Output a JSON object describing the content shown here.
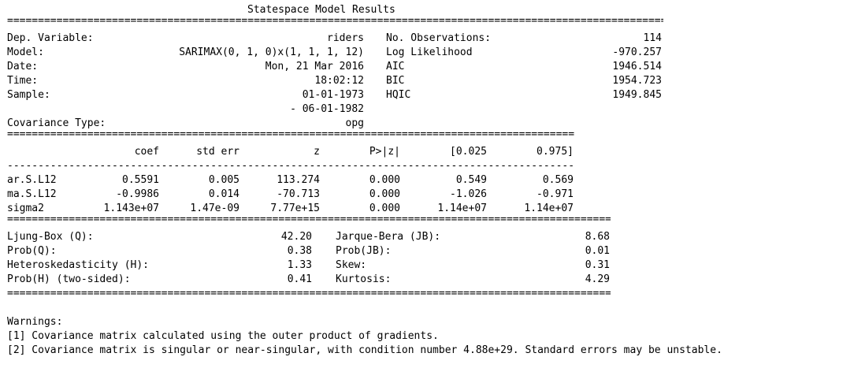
{
  "title": "Statespace Model Results",
  "header": {
    "dep_variable_label": "Dep. Variable:",
    "dep_variable_value": "riders",
    "model_label": "Model:",
    "model_value": "SARIMAX(0, 1, 0)x(1, 1, 1, 12)",
    "date_label": "Date:",
    "date_value": "Mon, 21 Mar 2016",
    "time_label": "Time:",
    "time_value": "18:02:12",
    "sample_label": "Sample:",
    "sample_value_1": "01-01-1973",
    "sample_value_2": "- 06-01-1982",
    "covtype_label": "Covariance Type:",
    "covtype_value": "opg",
    "nobs_label": "No. Observations:",
    "nobs_value": "114",
    "llf_label": "Log Likelihood",
    "llf_value": "-970.257",
    "aic_label": "AIC",
    "aic_value": "1946.514",
    "bic_label": "BIC",
    "bic_value": "1954.723",
    "hqic_label": "HQIC",
    "hqic_value": "1949.845"
  },
  "coef_table": {
    "columns": [
      "coef",
      "std err",
      "z",
      "P>|z|",
      "[0.025",
      "0.975]"
    ],
    "rows": [
      {
        "name": "ar.S.L12",
        "coef": "0.5591",
        "std_err": "0.005",
        "z": "113.274",
        "p": "0.000",
        "lo": "0.549",
        "hi": "0.569"
      },
      {
        "name": "ma.S.L12",
        "coef": "-0.9986",
        "std_err": "0.014",
        "z": "-70.713",
        "p": "0.000",
        "lo": "-1.026",
        "hi": "-0.971"
      },
      {
        "name": "sigma2",
        "coef": "1.143e+07",
        "std_err": "1.47e-09",
        "z": "7.77e+15",
        "p": "0.000",
        "lo": "1.14e+07",
        "hi": "1.14e+07"
      }
    ]
  },
  "diagnostics": {
    "left": [
      {
        "label": "Ljung-Box (Q):",
        "value": "42.20"
      },
      {
        "label": "Prob(Q):",
        "value": "0.38"
      },
      {
        "label": "Heteroskedasticity (H):",
        "value": "1.33"
      },
      {
        "label": "Prob(H) (two-sided):",
        "value": "0.41"
      }
    ],
    "right": [
      {
        "label": "Jarque-Bera (JB):",
        "value": "8.68"
      },
      {
        "label": "Prob(JB):",
        "value": "0.01"
      },
      {
        "label": "Skew:",
        "value": "0.31"
      },
      {
        "label": "Kurtosis:",
        "value": "4.29"
      }
    ]
  },
  "warnings": {
    "heading": "Warnings:",
    "items": [
      "[1] Covariance matrix calculated using the outer product of gradients.",
      "[2] Covariance matrix is singular or near-singular, with condition number 4.88e+29. Standard errors may be unstable."
    ]
  }
}
